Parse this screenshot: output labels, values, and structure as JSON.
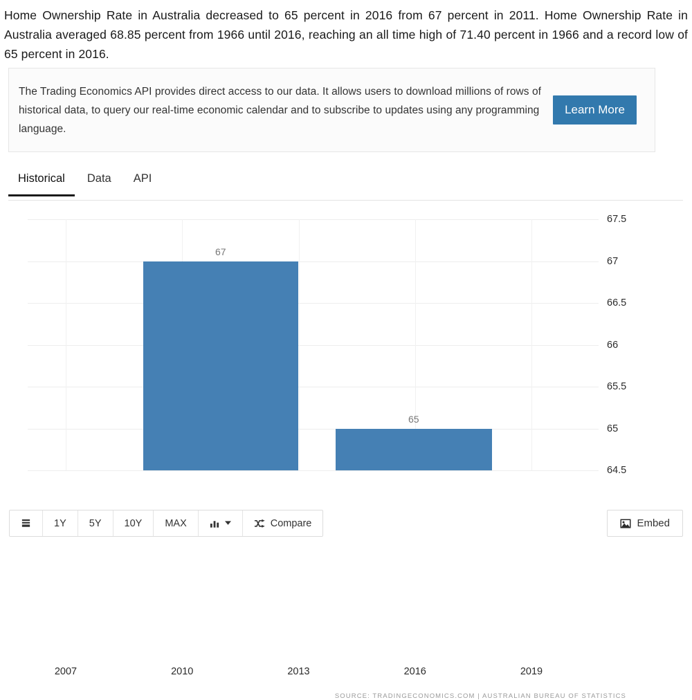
{
  "intro": {
    "text": "Home Ownership Rate in Australia decreased to 65 percent in 2016 from 67 percent in 2011. Home Ownership Rate in Australia averaged 68.85 percent from 1966 until 2016, reaching an all time high of 71.40 percent in 1966 and a record low of 65 percent in 2016."
  },
  "api_banner": {
    "text": "The Trading Economics API provides direct access to our data. It allows users to download millions of rows of historical data, to query our real-time economic calendar and to subscribe to updates using any programming language.",
    "button_label": "Learn More",
    "button_color": "#3279ad"
  },
  "tabs": [
    {
      "label": "Historical",
      "active": true
    },
    {
      "label": "Data",
      "active": false
    },
    {
      "label": "API",
      "active": false
    }
  ],
  "toolbar": {
    "list_icon": "list-icon",
    "ranges": [
      "1Y",
      "5Y",
      "10Y",
      "MAX"
    ],
    "chart_type_icon": "bar-chart-icon",
    "chart_type_caret": "chevron-down-icon",
    "compare_icon": "shuffle-icon",
    "compare_label": "Compare",
    "embed_icon": "image-icon",
    "embed_label": "Embed"
  },
  "chart_data": {
    "type": "bar",
    "title": "",
    "xlabel": "",
    "ylabel": "",
    "categories": [
      "2011",
      "2016"
    ],
    "values": [
      67,
      65
    ],
    "data_labels": [
      "67",
      "65"
    ],
    "bar_color": "#4580b4",
    "ylim": [
      64.5,
      67.5
    ],
    "yticks": [
      "67.5",
      "67",
      "66.5",
      "66",
      "65.5",
      "65",
      "64.5"
    ],
    "ytick_values": [
      67.5,
      67,
      66.5,
      66,
      65.5,
      65,
      64.5
    ],
    "xticks": [
      "2007",
      "2010",
      "2013",
      "2016",
      "2019"
    ],
    "xtick_values": [
      2007,
      2010,
      2013,
      2016,
      2019
    ],
    "grid": true,
    "legend": "none",
    "source": "SOURCE: TRADINGECONOMICS.COM  |  AUSTRALIAN BUREAU OF STATISTICS"
  }
}
